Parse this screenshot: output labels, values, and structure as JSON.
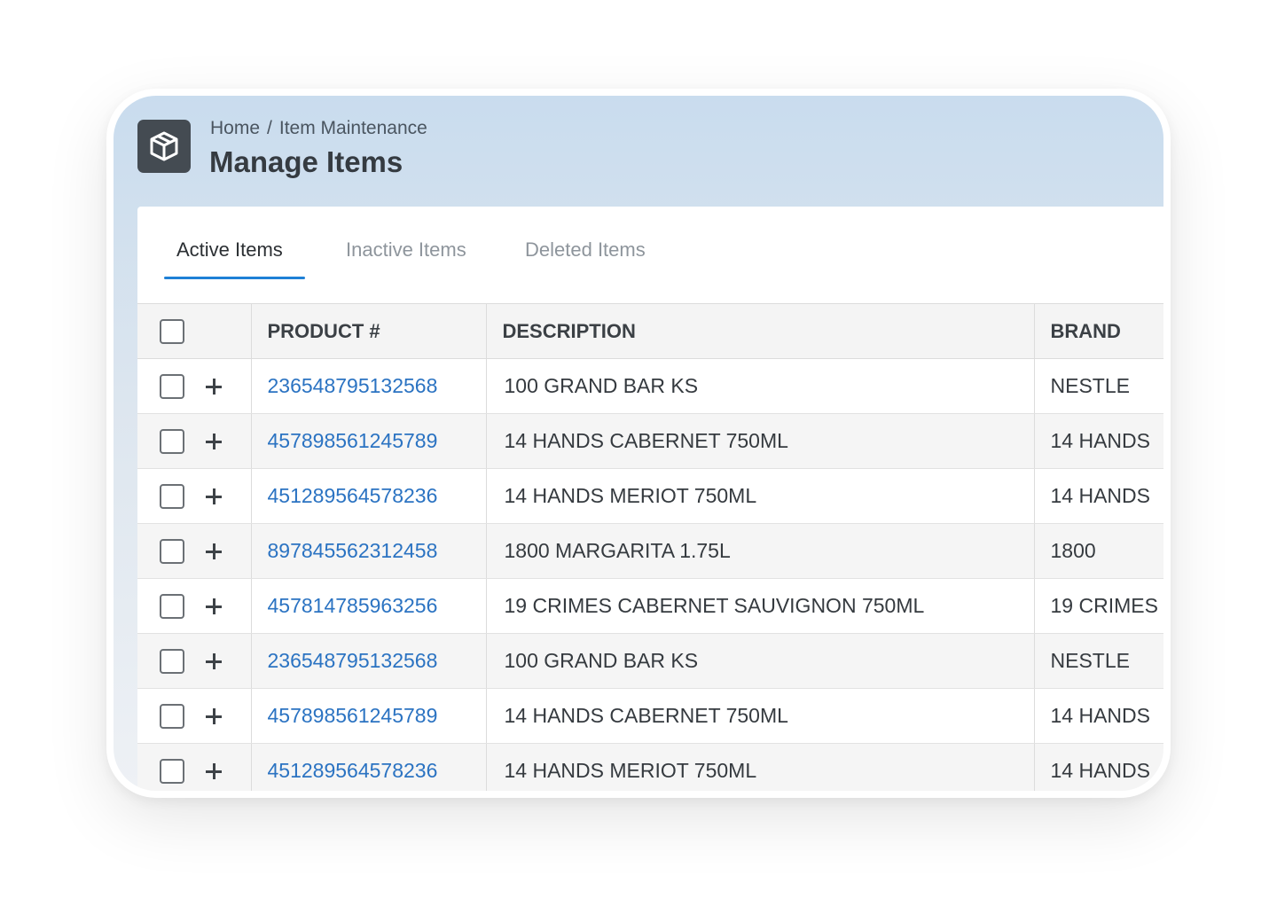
{
  "breadcrumb": {
    "home": "Home",
    "separator": "/",
    "current": "Item Maintenance"
  },
  "page_title": "Manage Items",
  "logo_icon": "package-box-icon",
  "tabs": [
    {
      "label": "Active Items",
      "active": true
    },
    {
      "label": "Inactive Items",
      "active": false
    },
    {
      "label": "Deleted Items",
      "active": false
    }
  ],
  "colors": {
    "accent": "#1f80d6",
    "link": "#2b73c2",
    "logo_bg": "#444b52"
  },
  "table": {
    "columns": [
      "PRODUCT #",
      "DESCRIPTION",
      "BRAND"
    ],
    "rows": [
      {
        "product": "236548795132568",
        "description": "100 GRAND BAR KS",
        "brand": "NESTLE"
      },
      {
        "product": "457898561245789",
        "description": "14 HANDS CABERNET 750ML",
        "brand": "14 HANDS"
      },
      {
        "product": "451289564578236",
        "description": "14 HANDS MERIOT 750ML",
        "brand": "14 HANDS"
      },
      {
        "product": "897845562312458",
        "description": "1800 MARGARITA 1.75L",
        "brand": "1800"
      },
      {
        "product": "457814785963256",
        "description": "19 CRIMES CABERNET SAUVIGNON 750ML",
        "brand": "19 CRIMES"
      },
      {
        "product": "236548795132568",
        "description": "100 GRAND BAR KS",
        "brand": "NESTLE"
      },
      {
        "product": "457898561245789",
        "description": "14 HANDS CABERNET 750ML",
        "brand": "14 HANDS"
      },
      {
        "product": "451289564578236",
        "description": "14 HANDS MERIOT 750ML",
        "brand": "14 HANDS"
      }
    ]
  }
}
